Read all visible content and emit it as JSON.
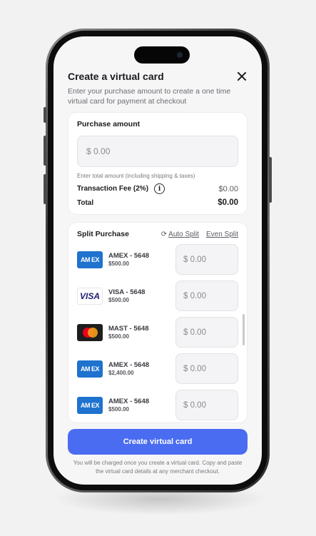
{
  "header": {
    "title": "Create a virtual card",
    "subtitle": "Enter your purchase amount to create a one time virtual card for payment at checkout"
  },
  "purchase": {
    "label": "Purchase amount",
    "amount_value": "$ 0.00",
    "hint": "Enter total amount (including shipping & taxes)",
    "fee_label": "Transaction Fee (2%)",
    "fee_value": "$0.00",
    "total_label": "Total",
    "total_value": "$0.00"
  },
  "split": {
    "label": "Split Purchase",
    "auto_split": "Auto Split",
    "even_split": "Even Split",
    "cards": [
      {
        "brand": "amex",
        "logo_text": "AM EX",
        "name": "AMEX - 5648",
        "balance": "$500.00",
        "amount": "$ 0.00"
      },
      {
        "brand": "visa",
        "logo_text": "VISA",
        "name": "VISA - 5648",
        "balance": "$500.00",
        "amount": "$ 0.00"
      },
      {
        "brand": "mast",
        "logo_text": "",
        "name": "MAST - 5648",
        "balance": "$500.00",
        "amount": "$ 0.00"
      },
      {
        "brand": "amex",
        "logo_text": "AM EX",
        "name": "AMEX - 5648",
        "balance": "$2,400.00",
        "amount": "$ 0.00"
      },
      {
        "brand": "amex",
        "logo_text": "AM EX",
        "name": "AMEX - 5648",
        "balance": "$500.00",
        "amount": "$ 0.00"
      }
    ]
  },
  "cta": {
    "label": "Create virtual card",
    "footnote": "You will be charged once you create a virtual card. Copy and paste the virtual card details at any merchant checkout."
  },
  "colors": {
    "accent": "#4a6cf0",
    "amex": "#1f72cd",
    "visa": "#1a1f71",
    "mastercard_red": "#eb001b",
    "mastercard_orange": "#f79e1b"
  }
}
